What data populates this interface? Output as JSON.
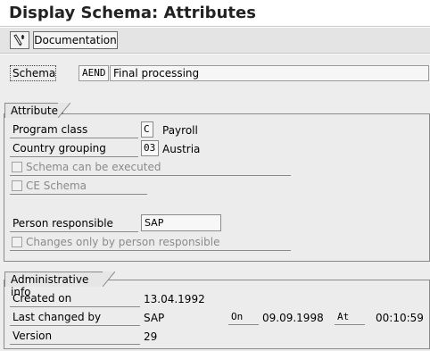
{
  "title": "Display Schema: Attributes",
  "toolbar": {
    "documentation_label": "Documentation",
    "icon": "wand-pencil-icon"
  },
  "schema": {
    "label": "Schema",
    "code": "AEND",
    "description": "Final processing"
  },
  "attributes": {
    "tab_label": "Attributes",
    "program_class": {
      "label": "Program class",
      "code": "C",
      "text": "Payroll"
    },
    "country_grouping": {
      "label": "Country grouping",
      "code": "03",
      "text": "Austria"
    },
    "can_execute": {
      "label": "Schema can be executed",
      "checked": false
    },
    "ce_schema": {
      "label": "CE Schema",
      "checked": false
    },
    "person_responsible": {
      "label": "Person responsible",
      "value": "SAP"
    },
    "changes_only": {
      "label": "Changes only by person responsible",
      "checked": false
    }
  },
  "admin": {
    "tab_label": "Administrative info",
    "created_on": {
      "label": "Created on",
      "value": "13.04.1992"
    },
    "last_changed_by": {
      "label": "Last changed by",
      "value": "SAP"
    },
    "on_label": "On",
    "on_date": "09.09.1998",
    "at_label": "At",
    "at_time": "00:10:59",
    "version": {
      "label": "Version",
      "value": "29"
    }
  }
}
